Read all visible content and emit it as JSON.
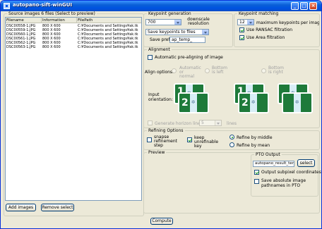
{
  "window": {
    "title": "autopano-sift-winGUI"
  },
  "source": {
    "legend": "Source images",
    "count_label": "6  files (Select to preview)",
    "columns": [
      "Filename",
      "Information",
      "FilePath"
    ],
    "rows": [
      [
        "DSC00558-1.JPG",
        "800 X 600",
        "C:¥Documents and Settings¥ak.tk"
      ],
      [
        "DSC00559-1.JPG",
        "800 X 600",
        "C:¥Documents and Settings¥ak.tk"
      ],
      [
        "DSC00560-1.JPG",
        "800 X 600",
        "C:¥Documents and Settings¥ak.tk"
      ],
      [
        "DSC00561-1.JPG",
        "800 X 600",
        "C:¥Documents and Settings¥ak.tk"
      ],
      [
        "DSC00562-1.JPG",
        "800 X 600",
        "C:¥Documents and Settings¥ak.tk"
      ],
      [
        "DSC00563-1.JPG",
        "800 X 600",
        "C:¥Documents and Settings¥ak.tk"
      ]
    ],
    "add_button": "Add images",
    "remove_button": "Remove select"
  },
  "keypoint_generation": {
    "legend": "Keypoint generation",
    "resolution_value": "700",
    "downscale_label": "downscale resolution",
    "save_mode": "Save keypoints to files",
    "save_prefix_label": "Save prefix",
    "save_prefix_value": "ap_temp_"
  },
  "keypoint_matching": {
    "legend": "Keypoint matching",
    "max_value": "12",
    "max_label": "maximum keypoints per image pair",
    "ransac_label": "Use RANSAC filtration",
    "area_label": "Use Area filtration"
  },
  "alignment": {
    "legend": "Alignment",
    "auto_label": "Automatic pre-aligning of image",
    "options_label": "Align options:",
    "radio_auto": "Automatic or normal",
    "radio_bottom_left": "Bottom is left",
    "radio_bottom_right": "Bottom is right",
    "input_orientation_label": "Input orientation:",
    "horizon_label": "Generate  horizon line",
    "horizon_value": "5",
    "lines_label": "lines",
    "pano_numbers": [
      "1",
      "2",
      "1",
      "2"
    ]
  },
  "refining": {
    "legend": "Refining Options",
    "snapshot_label": "snapse refinement step",
    "keep_label": "keep unrefinable key",
    "refine_middle": "Refine by middle",
    "refine_mean": "Refine by mean"
  },
  "preview": {
    "legend": "Preview"
  },
  "pto": {
    "legend": "PTO Output",
    "filename": "autopano_result_temp",
    "select_button": "select",
    "subpixel_label": "Output subpixel coordinates",
    "absolute_label": "Save absolute image pathnames in PTO"
  },
  "compute_button": "Compute"
}
